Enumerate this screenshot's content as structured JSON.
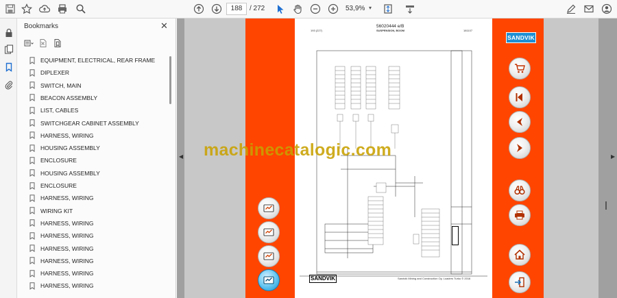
{
  "toolbar": {
    "page_current": "188",
    "page_total": "/ 272",
    "zoom": "53,9%",
    "icons": [
      "save-icon",
      "star-icon",
      "cloud-upload-icon",
      "print-icon",
      "magnifier-icon",
      "arrow-up-icon",
      "arrow-down-icon",
      "select-cursor-icon",
      "hand-icon",
      "zoom-out-icon",
      "zoom-in-icon",
      "fit-page-icon",
      "read-mode-icon",
      "edit-sign-icon",
      "email-icon",
      "account-icon"
    ]
  },
  "rail": {
    "icons": [
      "lock-icon",
      "pages-icon",
      "bookmark-icon",
      "attachment-icon"
    ]
  },
  "bookmarks": {
    "title": "Bookmarks",
    "close": "✕",
    "items": [
      "EQUIPMENT, ELECTRICAL, REAR FRAME",
      "DIPLEXER",
      "SWITCH, MAIN",
      "BEACON ASSEMBLY",
      "LIST, CABLES",
      "SWITCHGEAR CABINET ASSEMBLY",
      "HARNESS, WIRING",
      "HOUSING ASSEMBLY",
      "ENCLOSURE",
      "HOUSING ASSEMBLY",
      "ENCLOSURE",
      "HARNESS, WIRING",
      "WIRING KIT",
      "HARNESS, WIRING",
      "HARNESS, WIRING",
      "HARNESS, WIRING",
      "HARNESS, WIRING",
      "HARNESS, WIRING",
      "HARNESS, WIRING"
    ]
  },
  "document": {
    "number": "56020444 e/B",
    "header_left": "193 (227)",
    "header_center": "SUSPENSION, BOOM",
    "header_right": "181107",
    "footer_text": "Sandvik Mining and Construction Oy, Loaders Turku © 2016",
    "sheet_logo": "SANDVIK",
    "brand_logo": "SANDVIK",
    "watermark": "machinecatalogic.com"
  },
  "nav_left": [
    "catalog-icon",
    "catalog-icon",
    "catalog-icon",
    "catalog-active-icon"
  ],
  "nav_right": [
    "cart-icon",
    "first-page-icon",
    "previous-page-icon",
    "next-page-icon",
    "search-binoculars-icon",
    "printer-icon",
    "home-icon",
    "exit-icon"
  ],
  "colors": {
    "accent": "#ff4500",
    "brand": "#1e8fd4"
  }
}
